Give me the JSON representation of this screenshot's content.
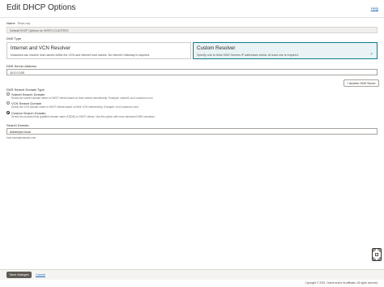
{
  "header": {
    "title": "Edit DHCP Options",
    "help_label": "Help"
  },
  "name_field": {
    "label": "Name",
    "read_only_tag": "Read-only",
    "value": "Default DHCP Options for WSFO-CLUSTER1"
  },
  "dns_type": {
    "label": "DNS Type",
    "options": [
      {
        "title": "Internet and VCN Resolver",
        "description": "Instances can resolve host names within the VCN and internet host names. No internet Gateway is required.",
        "selected": false
      },
      {
        "title": "Custom Resolver",
        "description": "Specify one to three DNS Servers IP addresses below. At least one is required.",
        "selected": true
      }
    ],
    "check_icon": "check-icon"
  },
  "dns_server": {
    "label": "DNS Server Address",
    "value": "10.0.0.100",
    "add_button_label": "+ Another DNS Server"
  },
  "search_domain_type": {
    "label": "DNS Search Domain Type",
    "options": [
      {
        "label": "Subnet Search Domain",
        "description": "Sends the subnet domain name to DHCP clients based on their subnet membership. Example: subnet1.vcn1.oraclevcn.com",
        "selected": false
      },
      {
        "label": "VCN Search Domain",
        "description": "Sends the VCN domain name to DHCP clients based on their VCN membership. Example: vcn1.oraclevcn.com",
        "selected": false
      },
      {
        "label": "Custom Search Domain",
        "description": "Sends the provided fully qualified domain name (FQDN) to DHCP clients. Use this option with more advanced DNS scenarios.",
        "selected": true
      }
    ]
  },
  "search_domain": {
    "label": "Search Domain",
    "value": "dotdeeper.local",
    "hint": "host.exampledomain.com"
  },
  "footer": {
    "save_label": "Save changes",
    "cancel_label": "Cancel",
    "copyright": "Copyright © 2023, Oracle and/or its affiliates. All rights reserved."
  },
  "zoom_control": {
    "icon": "zoom-fit-icon"
  },
  "colors": {
    "accent": "#0d7c8c",
    "link": "#1e6bb8",
    "primary_button": "#5f5a55"
  }
}
